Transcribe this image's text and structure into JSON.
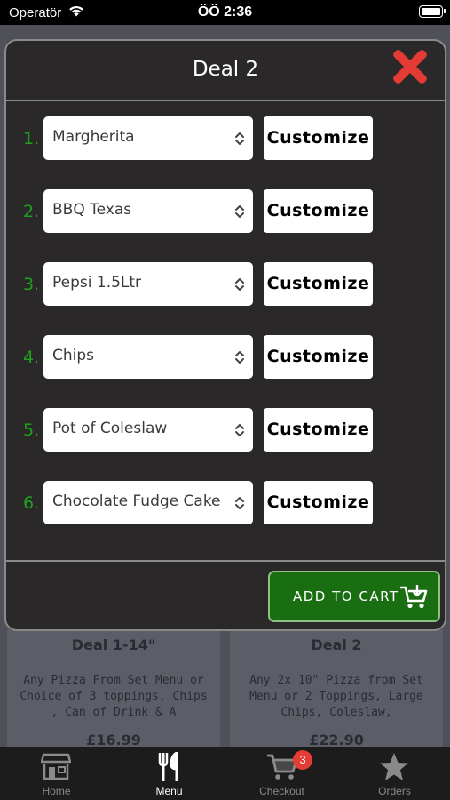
{
  "status_bar": {
    "carrier": "Operatör",
    "time": "ÖÖ 2:36"
  },
  "background_cards": [
    {
      "title": "Deal 1-14\"",
      "description": "Any Pizza From Set Menu or Choice of 3 toppings, Chips , Can of Drink & A",
      "price": "£16.99"
    },
    {
      "title": "Deal 2",
      "description": "Any 2x 10\" Pizza from Set Menu or 2 Toppings, Large Chips, Coleslaw,",
      "price": "£22.90"
    }
  ],
  "modal": {
    "title": "Deal 2",
    "close_icon": "close-x-icon",
    "items": [
      {
        "number": "1.",
        "selected": "Margherita",
        "button": "Customize"
      },
      {
        "number": "2.",
        "selected": "BBQ Texas",
        "button": "Customize"
      },
      {
        "number": "3.",
        "selected": "Pepsi 1.5Ltr",
        "button": "Customize"
      },
      {
        "number": "4.",
        "selected": "Chips",
        "button": "Customize"
      },
      {
        "number": "5.",
        "selected": "Pot of Coleslaw",
        "button": "Customize"
      },
      {
        "number": "6.",
        "selected": "Chocolate Fudge Cake",
        "button": "Customize"
      }
    ],
    "add_to_cart": "ADD TO CART"
  },
  "tab_bar": {
    "tabs": [
      {
        "label": "Home",
        "icon": "store-icon"
      },
      {
        "label": "Menu",
        "icon": "fork-knife-icon"
      },
      {
        "label": "Checkout",
        "icon": "cart-icon",
        "badge": "3"
      },
      {
        "label": "Orders",
        "icon": "star-icon"
      }
    ],
    "active": "Menu"
  },
  "colors": {
    "accent_green": "#1a6e12",
    "number_green": "#1f9f1f",
    "close_red": "#e53b35",
    "modal_bg": "#2a2828"
  }
}
